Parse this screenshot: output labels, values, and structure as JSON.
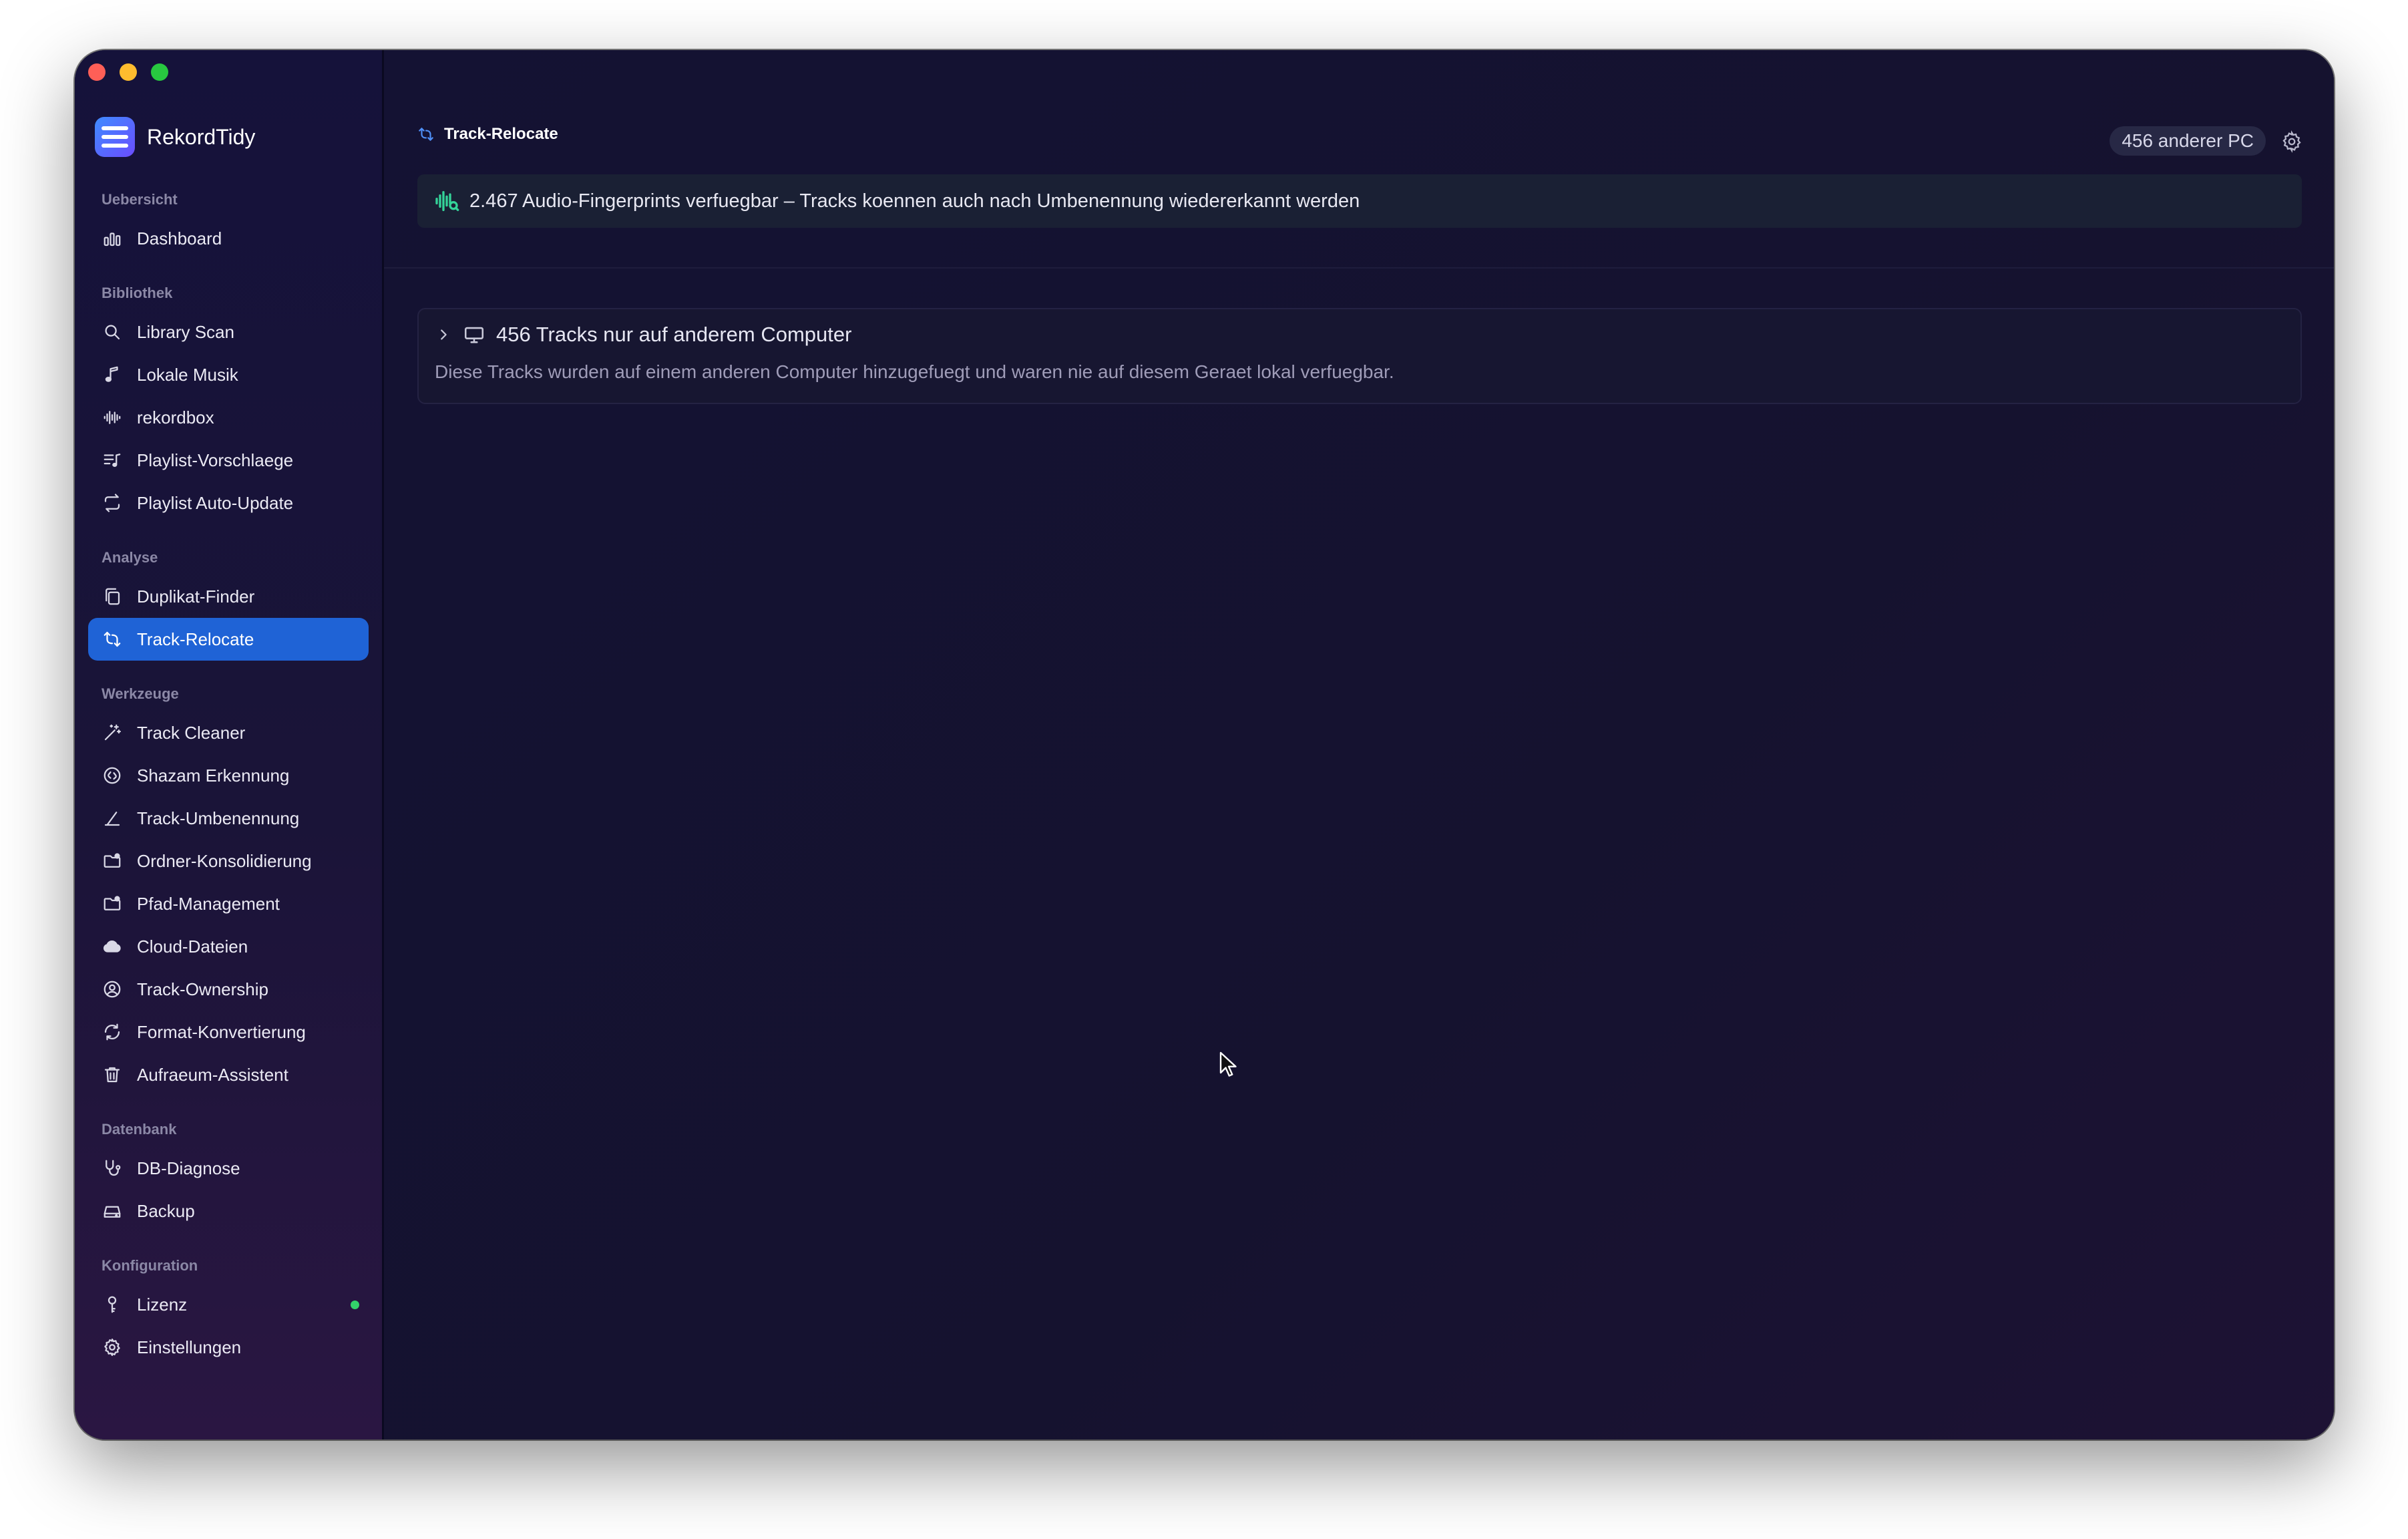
{
  "app": {
    "name": "RekordTidy"
  },
  "sidebar": {
    "sections": [
      {
        "title": "Uebersicht",
        "items": [
          {
            "label": "Dashboard",
            "icon": "bar-chart-icon",
            "slug": "dashboard"
          }
        ]
      },
      {
        "title": "Bibliothek",
        "items": [
          {
            "label": "Library Scan",
            "icon": "search-icon",
            "slug": "library-scan"
          },
          {
            "label": "Lokale Musik",
            "icon": "music-note-icon",
            "slug": "lokale-musik"
          },
          {
            "label": "rekordbox",
            "icon": "waveform-icon",
            "slug": "rekordbox"
          },
          {
            "label": "Playlist-Vorschlaege",
            "icon": "playlist-icon",
            "slug": "playlist-vorschlaege"
          },
          {
            "label": "Playlist Auto-Update",
            "icon": "repeat-icon",
            "slug": "playlist-auto-update"
          }
        ]
      },
      {
        "title": "Analyse",
        "items": [
          {
            "label": "Duplikat-Finder",
            "icon": "duplicate-icon",
            "slug": "duplikat-finder"
          },
          {
            "label": "Track-Relocate",
            "icon": "relocate-icon",
            "slug": "track-relocate",
            "active": true
          }
        ]
      },
      {
        "title": "Werkzeuge",
        "items": [
          {
            "label": "Track Cleaner",
            "icon": "magic-wand-icon",
            "slug": "track-cleaner"
          },
          {
            "label": "Shazam Erkennung",
            "icon": "shazam-icon",
            "slug": "shazam-erkennung"
          },
          {
            "label": "Track-Umbenennung",
            "icon": "rename-icon",
            "slug": "track-umbenennung"
          },
          {
            "label": "Ordner-Konsolidierung",
            "icon": "folder-gear-icon",
            "slug": "ordner-konsolidierung"
          },
          {
            "label": "Pfad-Management",
            "icon": "folder-gear-icon",
            "slug": "pfad-management"
          },
          {
            "label": "Cloud-Dateien",
            "icon": "cloud-icon",
            "slug": "cloud-dateien"
          },
          {
            "label": "Track-Ownership",
            "icon": "user-circle-icon",
            "slug": "track-ownership"
          },
          {
            "label": "Format-Konvertierung",
            "icon": "convert-icon",
            "slug": "format-konvertierung"
          },
          {
            "label": "Aufraeum-Assistent",
            "icon": "trash-icon",
            "slug": "aufraeum-assistent"
          }
        ]
      },
      {
        "title": "Datenbank",
        "items": [
          {
            "label": "DB-Diagnose",
            "icon": "stethoscope-icon",
            "slug": "db-diagnose"
          },
          {
            "label": "Backup",
            "icon": "backup-drive-icon",
            "slug": "backup"
          }
        ]
      },
      {
        "title": "Konfiguration",
        "items": [
          {
            "label": "Lizenz",
            "icon": "key-icon",
            "slug": "lizenz",
            "status_dot": "#33d36a"
          },
          {
            "label": "Einstellungen",
            "icon": "gear-icon",
            "slug": "einstellungen"
          }
        ]
      }
    ]
  },
  "main": {
    "title": "Track-Relocate",
    "count_pill": "456 anderer PC",
    "banner_text": "2.467 Audio-Fingerprints verfuegbar – Tracks koennen auch nach Umbenennung wiedererkannt werden",
    "group": {
      "title": "456 Tracks nur auf anderem Computer",
      "description": "Diese Tracks wurden auf einem anderen Computer hinzugefuegt und waren nie auf diesem Geraet lokal verfuegbar."
    }
  },
  "colors": {
    "accent": "#1f63d6",
    "fingerprint_green": "#34d399",
    "window_bg": "#120f2d"
  }
}
